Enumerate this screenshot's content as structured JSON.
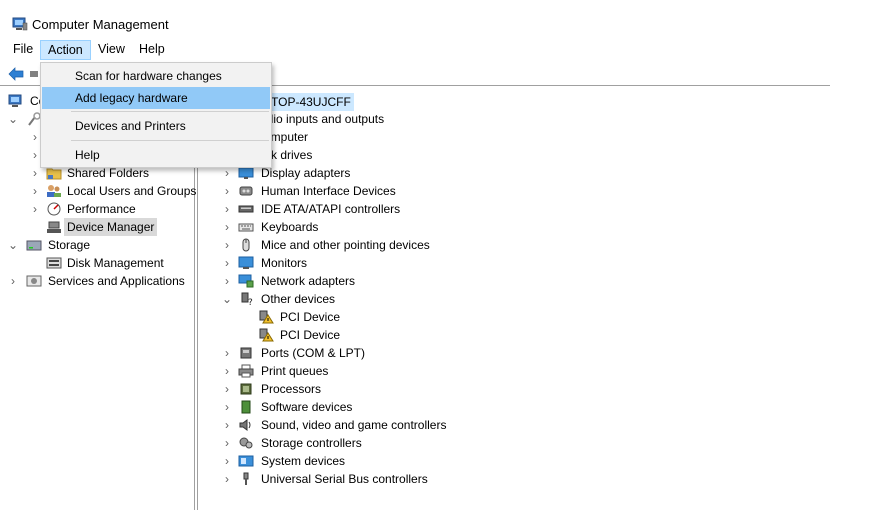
{
  "window": {
    "title": "Computer Management"
  },
  "menubar": {
    "file": "File",
    "action": "Action",
    "view": "View",
    "help": "Help"
  },
  "action_menu": {
    "items": [
      {
        "label": "Scan for hardware changes",
        "highlighted": false
      },
      {
        "label": "Add legacy hardware",
        "highlighted": true
      },
      {
        "label": "Devices and Printers",
        "highlighted": false
      },
      {
        "label": "Help",
        "highlighted": false
      }
    ]
  },
  "left_tree": {
    "root_fragment": "Co",
    "items": [
      {
        "label": "Shared Folders",
        "icon": "shared-folder-icon"
      },
      {
        "label": "Local Users and Groups",
        "icon": "users-icon"
      },
      {
        "label": "Performance",
        "icon": "performance-icon"
      },
      {
        "label": "Device Manager",
        "icon": "device-manager-icon",
        "selected": true
      },
      {
        "label": "Storage",
        "icon": "storage-icon"
      },
      {
        "label": "Disk Management",
        "icon": "disk-management-icon"
      },
      {
        "label": "Services and Applications",
        "icon": "services-icon"
      }
    ]
  },
  "device_tree": {
    "root_fragment": "TOP-43UJCFF",
    "partial_items": [
      {
        "label": "udio inputs and outputs",
        "icon": "audio-icon"
      },
      {
        "label": "omputer",
        "icon": "computer-icon"
      },
      {
        "label": "sk drives",
        "icon": "disk-drive-icon"
      }
    ],
    "items": [
      {
        "label": "Display adapters",
        "icon": "display-adapter-icon"
      },
      {
        "label": "Human Interface Devices",
        "icon": "hid-icon"
      },
      {
        "label": "IDE ATA/ATAPI controllers",
        "icon": "ide-icon"
      },
      {
        "label": "Keyboards",
        "icon": "keyboard-icon"
      },
      {
        "label": "Mice and other pointing devices",
        "icon": "mouse-icon"
      },
      {
        "label": "Monitors",
        "icon": "monitor-icon"
      },
      {
        "label": "Network adapters",
        "icon": "network-adapter-icon"
      },
      {
        "label": "Other devices",
        "icon": "other-devices-icon",
        "expanded": true
      },
      {
        "label": "PCI Device",
        "icon": "warning-device-icon",
        "child": true
      },
      {
        "label": "PCI Device",
        "icon": "warning-device-icon",
        "child": true
      },
      {
        "label": "Ports (COM & LPT)",
        "icon": "port-icon"
      },
      {
        "label": "Print queues",
        "icon": "printer-icon"
      },
      {
        "label": "Processors",
        "icon": "processor-icon"
      },
      {
        "label": "Software devices",
        "icon": "software-device-icon"
      },
      {
        "label": "Sound, video and game controllers",
        "icon": "sound-icon"
      },
      {
        "label": "Storage controllers",
        "icon": "storage-controller-icon"
      },
      {
        "label": "System devices",
        "icon": "system-devices-icon"
      },
      {
        "label": "Universal Serial Bus controllers",
        "icon": "usb-icon"
      }
    ]
  }
}
